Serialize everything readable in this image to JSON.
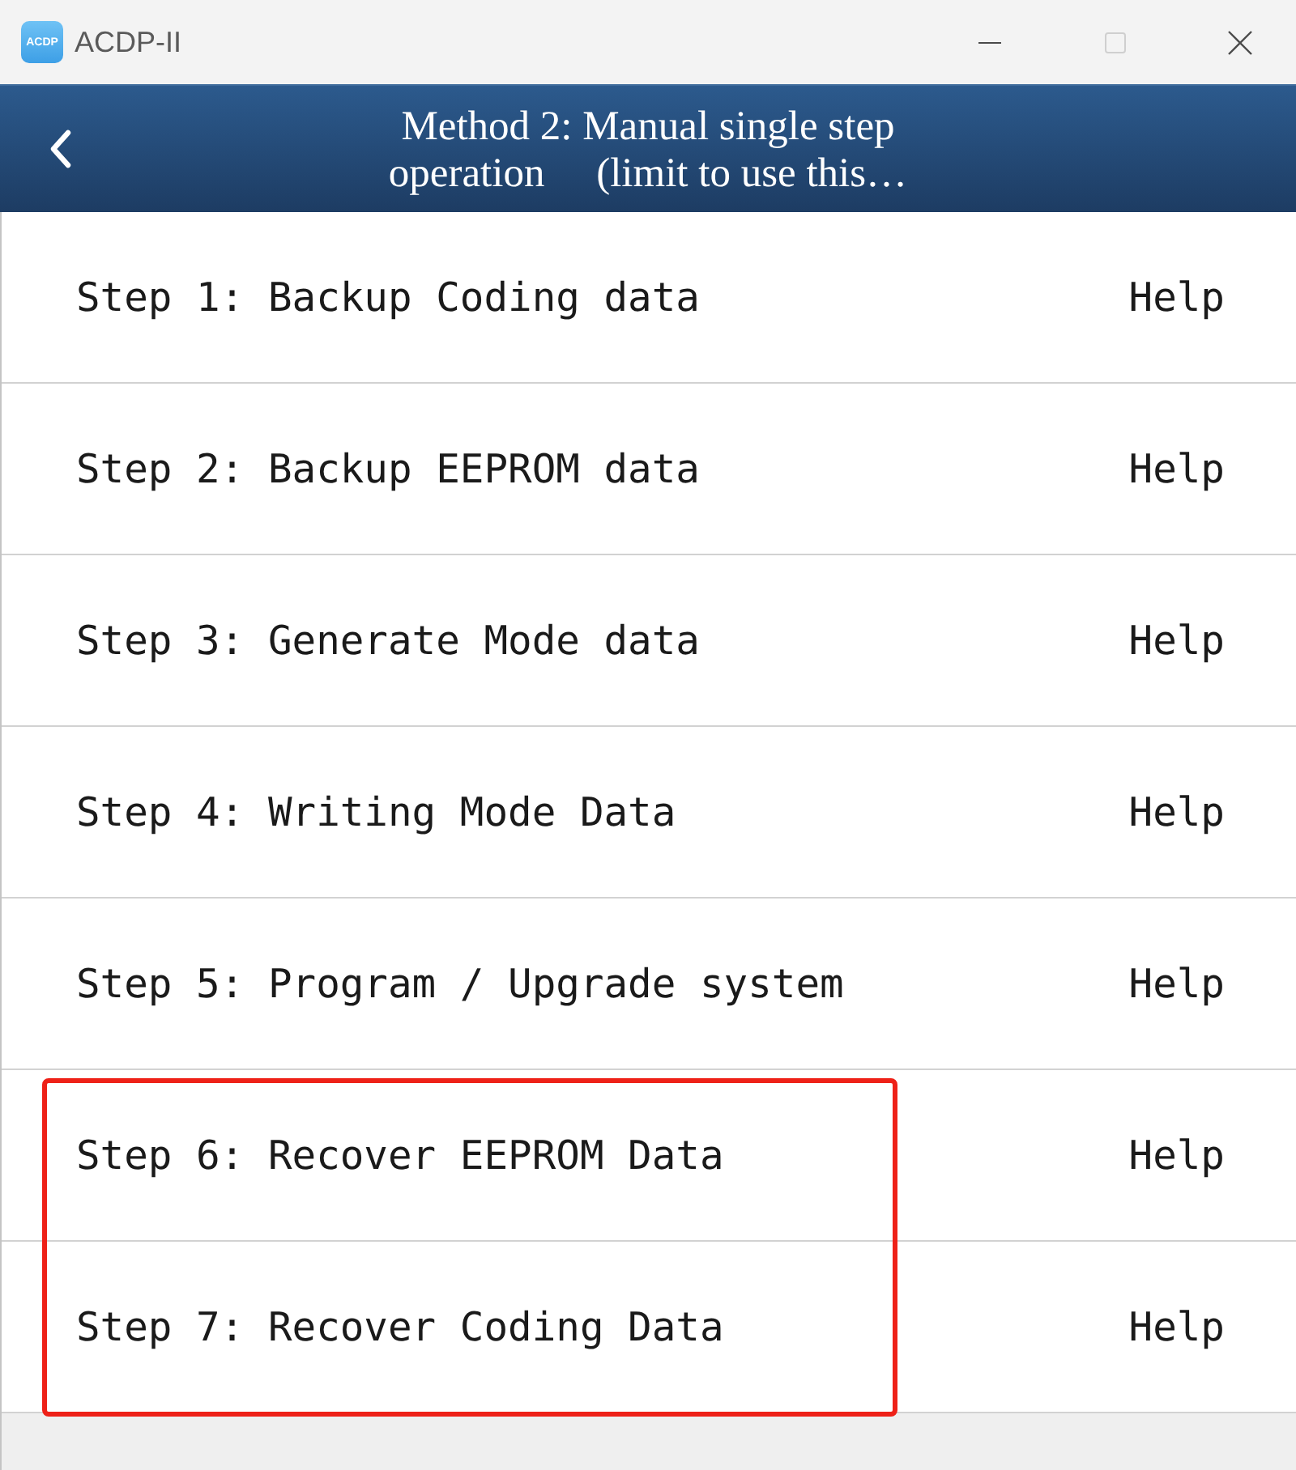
{
  "window": {
    "title": "ACDP-II",
    "app_icon_text": "ACDP",
    "controls": [
      {
        "kind": "minimize",
        "disabled": false
      },
      {
        "kind": "maximize",
        "disabled": true
      },
      {
        "kind": "close",
        "disabled": false
      }
    ]
  },
  "header": {
    "title": "Method 2: Manual single step\noperation     (limit to use this…"
  },
  "steps": [
    {
      "label": "Step 1: Backup Coding data",
      "help": "Help",
      "highlighted": false
    },
    {
      "label": "Step 2: Backup EEPROM data",
      "help": "Help",
      "highlighted": false
    },
    {
      "label": "Step 3: Generate Mode data",
      "help": "Help",
      "highlighted": false
    },
    {
      "label": "Step 4: Writing Mode Data",
      "help": "Help",
      "highlighted": false
    },
    {
      "label": "Step 5: Program / Upgrade system",
      "help": "Help",
      "highlighted": false
    },
    {
      "label": "Step 6: Recover EEPROM Data",
      "help": "Help",
      "highlighted": true
    },
    {
      "label": "Step 7: Recover Coding Data",
      "help": "Help",
      "highlighted": true
    }
  ]
}
